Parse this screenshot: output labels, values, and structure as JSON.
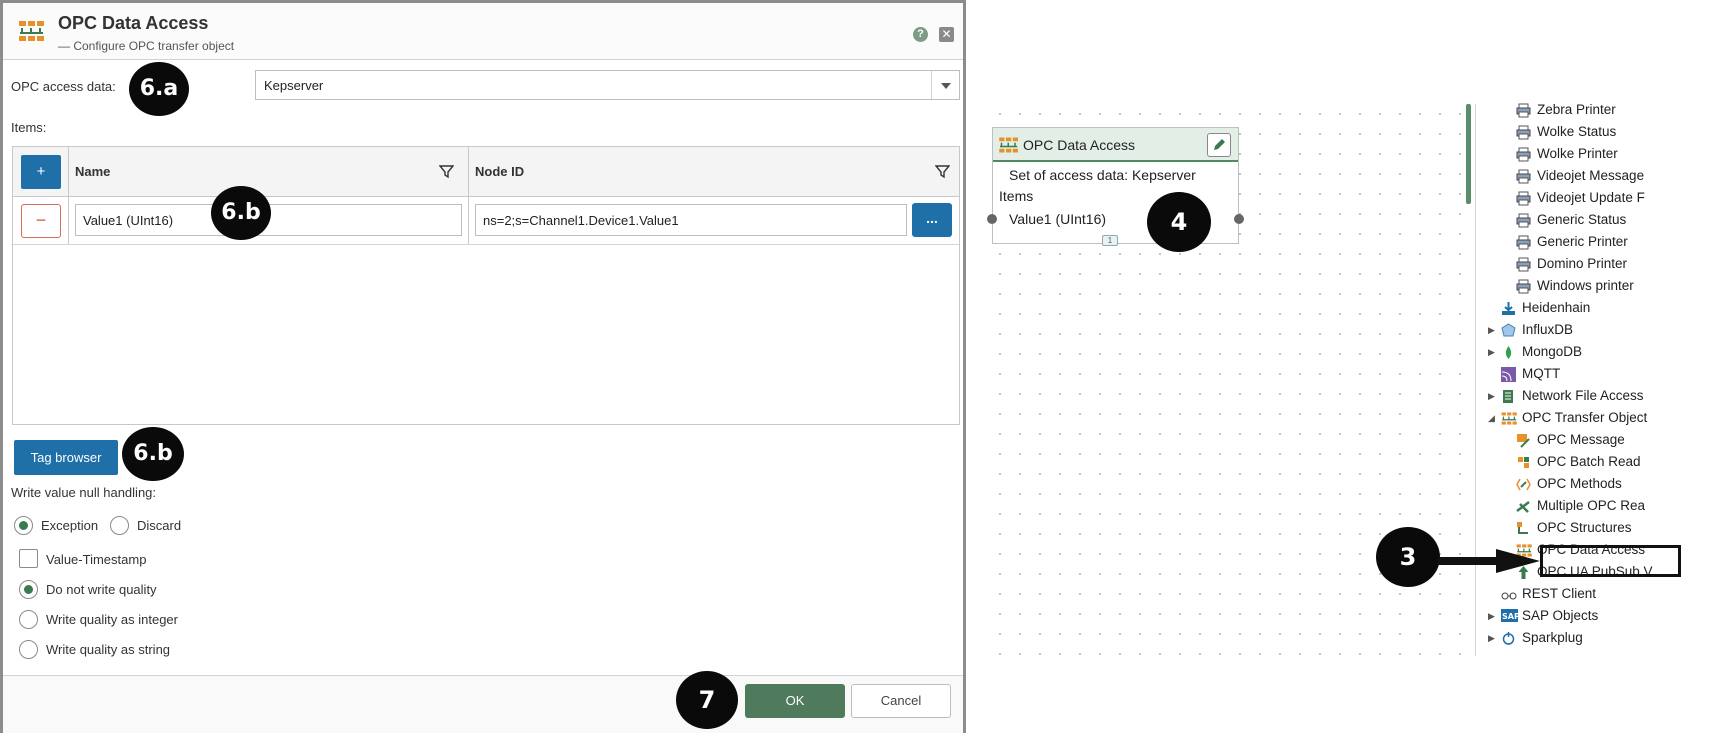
{
  "dialog": {
    "title": "OPC Data Access",
    "subtitle": "— Configure OPC transfer object",
    "help": "?",
    "close": "✕"
  },
  "form": {
    "access_label": "OPC access data:",
    "access_value": "Kepserver",
    "items_label": "Items:",
    "columns": {
      "add": "+",
      "name": "Name",
      "node_id": "Node ID"
    },
    "rows": [
      {
        "remove": "−",
        "name": "Value1 (UInt16)",
        "node_id": "ns=2;s=Channel1.Device1.Value1",
        "more": "..."
      }
    ],
    "tag_browser": "Tag browser",
    "null_label": "Write value null handling:",
    "null_options": [
      {
        "label": "Exception",
        "selected": true
      },
      {
        "label": "Discard",
        "selected": false
      }
    ],
    "value_timestamp": {
      "label": "Value-Timestamp",
      "checked": false
    },
    "quality_options": [
      {
        "label": "Do not write quality",
        "selected": true
      },
      {
        "label": "Write quality as integer",
        "selected": false
      },
      {
        "label": "Write quality as string",
        "selected": false
      }
    ],
    "ok": "OK",
    "cancel": "Cancel"
  },
  "badges": {
    "b6a": "6.a",
    "b6b_row": "6.b",
    "b6b_tag": "6.b",
    "b7": "7",
    "b4": "4",
    "b3": "3"
  },
  "node": {
    "title": "OPC Data Access",
    "line1": "Set of access data: Kepserver",
    "line2": "Items",
    "line3": "Value1 (UInt16)",
    "count": "1"
  },
  "tree": {
    "items": [
      {
        "label": "Zebra Printer",
        "icon": "printer-icon"
      },
      {
        "label": "Wolke Status",
        "icon": "printer-icon"
      },
      {
        "label": "Wolke Printer",
        "icon": "printer-icon"
      },
      {
        "label": "Videojet Message",
        "icon": "printer-icon"
      },
      {
        "label": "Videojet Update F",
        "icon": "printer-icon"
      },
      {
        "label": "Generic Status",
        "icon": "printer-icon"
      },
      {
        "label": "Generic Printer",
        "icon": "printer-icon"
      },
      {
        "label": "Domino Printer",
        "icon": "printer-icon"
      },
      {
        "label": "Windows printer",
        "icon": "printer-icon"
      },
      {
        "label": "Heidenhain",
        "icon": "heidenhain-icon"
      },
      {
        "label": "InfluxDB",
        "icon": "influxdb-icon"
      },
      {
        "label": "MongoDB",
        "icon": "mongodb-icon"
      },
      {
        "label": "MQTT",
        "icon": "mqtt-icon"
      },
      {
        "label": "Network File Access",
        "icon": "file-icon"
      },
      {
        "label": "OPC Transfer Object",
        "icon": "opc-icon"
      },
      {
        "label": "OPC Message",
        "icon": "opc-message-icon"
      },
      {
        "label": "OPC Batch Read",
        "icon": "opc-batch-icon"
      },
      {
        "label": "OPC Methods",
        "icon": "opc-methods-icon"
      },
      {
        "label": "Multiple OPC Rea",
        "icon": "opc-multiple-icon"
      },
      {
        "label": "OPC Structures",
        "icon": "opc-structures-icon"
      },
      {
        "label": "OPC Data Access",
        "icon": "opc-icon"
      },
      {
        "label": "OPC UA PubSub V",
        "icon": "pubsub-icon"
      },
      {
        "label": "REST Client",
        "icon": "rest-icon"
      },
      {
        "label": "SAP Objects",
        "icon": "sap-icon"
      },
      {
        "label": "Sparkplug",
        "icon": "sparkplug-icon"
      }
    ]
  },
  "colors": {
    "primary": "#1f6fa8",
    "ok": "#4f7a5c",
    "accent": "#3b7a4e",
    "badge": "#0a0a0a"
  }
}
